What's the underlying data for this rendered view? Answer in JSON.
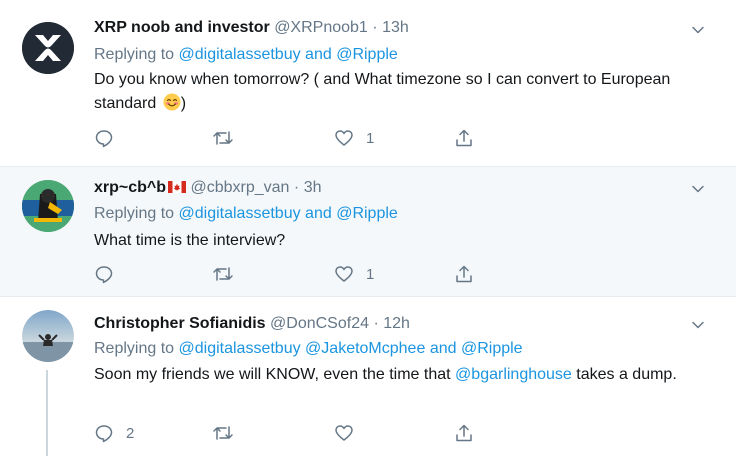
{
  "colors": {
    "link": "#1b95e0",
    "secondary": "#657786",
    "divider": "#e6ecf0",
    "highlight_bg": "#f5f8fa"
  },
  "tweets": [
    {
      "name": "XRP noob and investor",
      "handle": "@XRPnoob1",
      "dot": "·",
      "time": "13h",
      "replying_prefix": "Replying to",
      "replying_links": [
        "@digitalassetbuy",
        "and",
        "@Ripple"
      ],
      "text": "Do you know when tomorrow? ( and What timezone so I can convert to European standard",
      "text_suffix": ")",
      "emoji": "smiling-face-emoji",
      "reply_count": "",
      "retweet_count": "",
      "like_count": "1"
    },
    {
      "name": "xrp~cb^b",
      "flag": "canada-flag",
      "handle": "@cbbxrp_van",
      "dot": "·",
      "time": "3h",
      "replying_prefix": "Replying to",
      "replying_links": [
        "@digitalassetbuy",
        "and",
        "@Ripple"
      ],
      "text": "What time is the interview?",
      "reply_count": "",
      "retweet_count": "",
      "like_count": "1"
    },
    {
      "name": "Christopher Sofianidis",
      "handle": "@DonCSof24",
      "dot": "·",
      "time": "12h",
      "replying_prefix": "Replying to",
      "replying_links": [
        "@digitalassetbuy",
        "@JaketoMcphee",
        "and",
        "@Ripple"
      ],
      "text_before": "Soon my friends we will KNOW, even the time that",
      "text_mention": "@bgarlinghouse",
      "text_after": "takes a dump.",
      "reply_count": "2",
      "retweet_count": "",
      "like_count": ""
    }
  ]
}
